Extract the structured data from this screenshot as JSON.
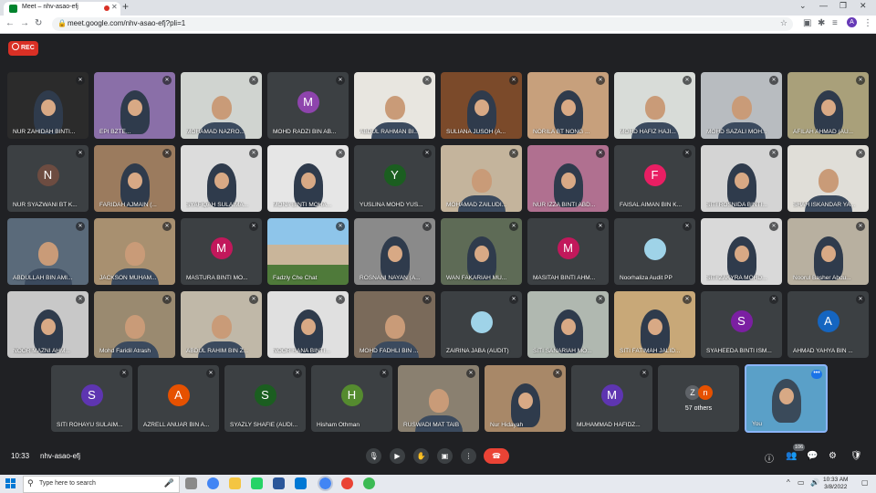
{
  "browser": {
    "tab_title": "Meet – nhv-asao-efj",
    "url": "meet.google.com/nhv-asao-efj?pli=1",
    "profile_initial": "A"
  },
  "meet": {
    "rec_label": "REC",
    "you_label": "You",
    "others": {
      "count_label": "57 others",
      "initials": [
        "Z",
        "n"
      ]
    },
    "time": "10:33",
    "meeting_code": "nhv-asao-efj",
    "people_badge": "106"
  },
  "colors": {
    "meet_bg": "#202124",
    "tile_bg": "#3c4043",
    "rec_red": "#d93025",
    "end_call": "#ea4335",
    "you_border": "#8ab4f8"
  },
  "tiles": [
    {
      "name": "NUR ZAHIDAH BINTI...",
      "kind": "hijab",
      "c": "#2b2b2b"
    },
    {
      "name": "EPI BZTE...",
      "kind": "hijab",
      "c": "#8a6fa8"
    },
    {
      "name": "MOHAMAD NAZRO...",
      "kind": "man",
      "c": "#d0d4d0"
    },
    {
      "name": "MOHD RADZI BIN AB...",
      "kind": "avatar",
      "letter": "M",
      "av": "#8e44ad"
    },
    {
      "name": "ABDUL RAHMAN BI...",
      "kind": "man",
      "c": "#e8e6e0"
    },
    {
      "name": "SULIANA JUSOH (A...",
      "kind": "hijab",
      "c": "#7b4a2a"
    },
    {
      "name": "NORILA BT NONG ...",
      "kind": "hijab",
      "c": "#c7a07c"
    },
    {
      "name": "MOHD HAFIZ HAJI...",
      "kind": "man",
      "c": "#d8dcd8"
    },
    {
      "name": "MOHD SAZALI MOH...",
      "kind": "man",
      "c": "#b8bcc0"
    },
    {
      "name": "AFILAH AHMAD (AU...",
      "kind": "hijab",
      "c": "#a9a07a"
    },
    {
      "name": "NUR SYAZWANI BT K...",
      "kind": "avatar",
      "letter": "N",
      "av": "#6d4c41"
    },
    {
      "name": "FARIDAH AJMAIN (...",
      "kind": "hijab",
      "c": "#9b7b5e"
    },
    {
      "name": "SYAFIQAH SULAIMA...",
      "kind": "hijab",
      "c": "#dcdcdc"
    },
    {
      "name": "MONA BINTI MOHA...",
      "kind": "hijab",
      "c": "#e6e6e6"
    },
    {
      "name": "YUSLINA MOHD YUS...",
      "kind": "avatar",
      "letter": "Y",
      "av": "#1b5e20"
    },
    {
      "name": "MOHAMAD ZAILUDI...",
      "kind": "man",
      "c": "#c4b49c"
    },
    {
      "name": "NUR IZZA BINTI ABD...",
      "kind": "hijab",
      "c": "#b07090"
    },
    {
      "name": "FAISAL AIMAN BIN K...",
      "kind": "avatar",
      "letter": "F",
      "av": "#e91e63"
    },
    {
      "name": "SITI ROSNIDA BINTI...",
      "kind": "hijab",
      "c": "#d4d4d4"
    },
    {
      "name": "SHAH ISKANDAR YA...",
      "kind": "man",
      "c": "#e0ded8"
    },
    {
      "name": "ABDULLAH BIN AMI...",
      "kind": "man",
      "c": "#5a6a7a"
    },
    {
      "name": "JACKSON MUHAM...",
      "kind": "man",
      "c": "#a89070"
    },
    {
      "name": "MASTURA BINTI MO...",
      "kind": "avatar",
      "letter": "M",
      "av": "#c2185b"
    },
    {
      "name": "Fadzly Che Chat",
      "kind": "building",
      "c": "#7fb0d8"
    },
    {
      "name": "ROSNANI NAYAN (A...",
      "kind": "hijab",
      "c": "#8a8a8a"
    },
    {
      "name": "WAN FAKARIAH MU...",
      "kind": "hijab",
      "c": "#5e6b56"
    },
    {
      "name": "MASITAH BINTI AHM...",
      "kind": "avatar",
      "letter": "M",
      "av": "#c2185b"
    },
    {
      "name": "Noorhaliza Audit PP",
      "kind": "picture",
      "c": "#3c4043"
    },
    {
      "name": "SITI ZAKYRA MOHD...",
      "kind": "hijab",
      "c": "#d9d9d9"
    },
    {
      "name": "Noorul Basher Abdu...",
      "kind": "hijab",
      "c": "#b8b0a0"
    },
    {
      "name": "NOOR MAZNI AHM...",
      "kind": "hijab",
      "c": "#c8c8c8"
    },
    {
      "name": "Mohd Faridil Atrash",
      "kind": "man",
      "c": "#9a8a70"
    },
    {
      "name": "ABDUL RAHIM BIN Z...",
      "kind": "man",
      "c": "#c0b8a8"
    },
    {
      "name": "NOOR HANA BINTI...",
      "kind": "hijab",
      "c": "#e0e0e0"
    },
    {
      "name": "MOHD FADHLI BIN ...",
      "kind": "man",
      "c": "#7a6a5a"
    },
    {
      "name": "ZAIRINA JABA (AUDIT)",
      "kind": "picture",
      "c": "#3c4043"
    },
    {
      "name": "SITI SANARIAH MO...",
      "kind": "hijab",
      "c": "#b0b8b0"
    },
    {
      "name": "SITI FATIMAH JALID...",
      "kind": "hijab",
      "c": "#c8a878"
    },
    {
      "name": "SYAHEEDA BINTI ISM...",
      "kind": "avatar",
      "letter": "S",
      "av": "#7b1fa2"
    },
    {
      "name": "AHMAD YAHYA BIN ...",
      "kind": "avatar",
      "letter": "A",
      "av": "#1565c0"
    },
    {
      "name": "SITI ROHAYU SULAIM...",
      "kind": "avatar",
      "letter": "S",
      "av": "#5e35b1"
    },
    {
      "name": "AZRELL ANUAR BIN A...",
      "kind": "avatar",
      "letter": "A",
      "av": "#e65100"
    },
    {
      "name": "SYAZLY SHAFIE (AUDI...",
      "kind": "avatar",
      "letter": "S",
      "av": "#1b5e20"
    },
    {
      "name": "Hisham Othman",
      "kind": "avatar",
      "letter": "H",
      "av": "#558b2f"
    },
    {
      "name": "RUSWADI MAT TAIB",
      "kind": "man",
      "c": "#8a8070"
    },
    {
      "name": "Nur Hidayah",
      "kind": "hijab",
      "c": "#a88868"
    },
    {
      "name": "MUHAMMAD HAFIDZ...",
      "kind": "avatar",
      "letter": "M",
      "av": "#5e35b1"
    }
  ],
  "taskbar": {
    "search_placeholder": "Type here to search",
    "clock_time": "10:33 AM",
    "clock_date": "3/8/2022"
  }
}
